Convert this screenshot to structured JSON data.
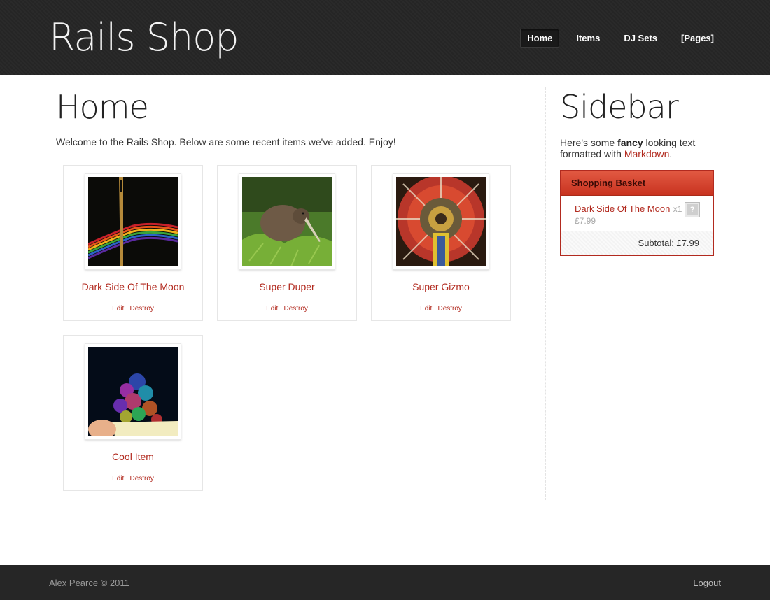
{
  "header": {
    "brand": "Rails Shop",
    "nav": [
      {
        "label": "Home",
        "active": true
      },
      {
        "label": "Items"
      },
      {
        "label": "DJ Sets"
      },
      {
        "label": "[Pages]"
      }
    ]
  },
  "main": {
    "title": "Home",
    "welcome": "Welcome to the Rails Shop. Below are some recent items we've added. Enjoy!",
    "items": [
      {
        "title": "Dark Side Of The Moon",
        "image": "rainbow-threads-needle-image",
        "edit": "Edit",
        "destroy": "Destroy"
      },
      {
        "title": "Super Duper",
        "image": "kiwi-bird-image",
        "edit": "Edit",
        "destroy": "Destroy"
      },
      {
        "title": "Super Gizmo",
        "image": "particle-detector-image",
        "edit": "Edit",
        "destroy": "Destroy"
      },
      {
        "title": "Cool Item",
        "image": "bokeh-lights-mug-image",
        "edit": "Edit",
        "destroy": "Destroy"
      }
    ],
    "separator": "|"
  },
  "sidebar": {
    "title": "Sidebar",
    "text_before": "Here's some ",
    "text_bold": "fancy",
    "text_middle": " looking text formatted with ",
    "text_link": "Markdown",
    "text_after": ".",
    "basket": {
      "title": "Shopping Basket",
      "item_name": "Dark Side Of The Moon",
      "item_qty": "x1",
      "item_price": "£7.99",
      "remove_icon": "?",
      "subtotal": "Subtotal: £7.99"
    }
  },
  "footer": {
    "copyright": "Alex Pearce © 2011",
    "logout": "Logout"
  },
  "colors": {
    "header_bg": "#262626",
    "accent": "#b22a1f",
    "basket_header": "#d4412b"
  }
}
